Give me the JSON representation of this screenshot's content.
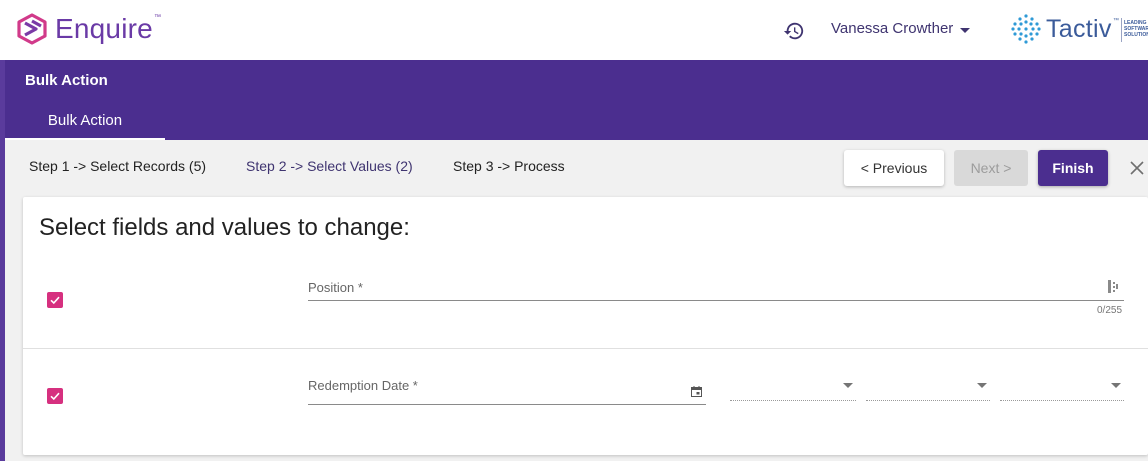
{
  "app": {
    "logo_text": "Enquire",
    "logo_tm": "™",
    "user_name": "Vanessa Crowther",
    "partner_logo": "Tactiv",
    "partner_tm": "™",
    "partner_tagline": "LEADING\nSOFTWARE\nSOLUTIONS"
  },
  "header": {
    "title": "Bulk Action",
    "tabs": [
      {
        "label": "Bulk Action",
        "active": true
      }
    ]
  },
  "steps": [
    {
      "label": "Step 1 -> Select Records (5)",
      "state": "done"
    },
    {
      "label": "Step 2 -> Select Values (2)",
      "state": "active"
    },
    {
      "label": "Step 3 -> Process",
      "state": "pending"
    }
  ],
  "buttons": {
    "previous": "< Previous",
    "next": "Next >",
    "finish": "Finish"
  },
  "card": {
    "title": "Select fields and values to change:",
    "fields": [
      {
        "label": "Position *",
        "value": "",
        "checked": true,
        "counter": "0/255"
      },
      {
        "label": "Redemption Date *",
        "value": "",
        "checked": true
      }
    ]
  },
  "colors": {
    "brand_purple": "#4b2e8f",
    "checkbox_pink": "#d6307f",
    "step_active": "#3f3470",
    "tactiv_blue": "#3b5b9a"
  },
  "icons": {
    "history": "history-icon",
    "user_menu": "chevron-down-icon",
    "close": "close-icon",
    "calendar": "calendar-icon",
    "list": "list-icon",
    "checkbox": "check-icon"
  }
}
